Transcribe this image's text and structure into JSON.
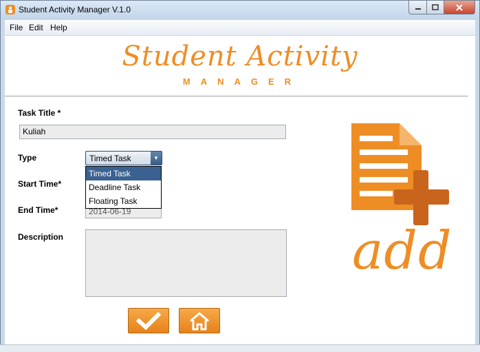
{
  "window": {
    "title": "Student Activity Manager V.1.0"
  },
  "menu": {
    "items": [
      "File",
      "Edit",
      "Help"
    ]
  },
  "logo": {
    "title": "Student Activity",
    "subtitle": "MANAGER"
  },
  "form": {
    "task_title_label": "Task Title *",
    "task_title_value": "Kuliah",
    "type_label": "Type",
    "type_value": "Timed Task",
    "type_options": [
      "Timed Task",
      "Deadline Task",
      "Floating Task"
    ],
    "start_time_label": "Start Time*",
    "end_time_label": "End Time*",
    "end_time_value": "2014-06-19",
    "description_label": "Description",
    "description_value": ""
  },
  "side": {
    "add_text": "add"
  },
  "icons": {
    "confirm": "check-icon",
    "home": "home-icon",
    "add": "document-add-icon"
  },
  "colors": {
    "accent": "#ef8d25",
    "selected": "#3a618f"
  }
}
